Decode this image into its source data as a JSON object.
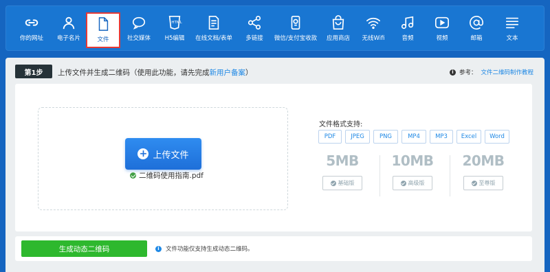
{
  "nav": {
    "items": [
      {
        "label": "你的网址",
        "icon": "link-icon"
      },
      {
        "label": "电子名片",
        "icon": "person-icon"
      },
      {
        "label": "文件",
        "icon": "file-icon",
        "active": true
      },
      {
        "label": "社交媒体",
        "icon": "chat-bubble-icon"
      },
      {
        "label": "H5编辑",
        "icon": "html5-icon"
      },
      {
        "label": "在线文档/表单",
        "icon": "document-icon"
      },
      {
        "label": "多链接",
        "icon": "share-icon"
      },
      {
        "label": "微信/支付宝收款",
        "icon": "payment-icon"
      },
      {
        "label": "应用商店",
        "icon": "shopping-bag-icon"
      },
      {
        "label": "无线Wifi",
        "icon": "wifi-icon"
      },
      {
        "label": "音频",
        "icon": "music-note-icon"
      },
      {
        "label": "视频",
        "icon": "play-icon"
      },
      {
        "label": "邮箱",
        "icon": "at-sign-icon"
      },
      {
        "label": "文本",
        "icon": "text-lines-icon"
      }
    ]
  },
  "step": {
    "badge": "第1步",
    "title_prefix": "上传文件并生成二维码（使用此功能，请先完成",
    "title_link": "新用户备案",
    "title_suffix": "）",
    "ref_label": "参考：",
    "ref_link": "文件二维码制作教程"
  },
  "upload": {
    "button_label": "上传文件",
    "file_name": "二维码使用指南.pdf"
  },
  "formats": {
    "title": "文件格式支持:",
    "items": [
      "PDF",
      "JPEG",
      "PNG",
      "MP4",
      "MP3",
      "Excel",
      "Word"
    ]
  },
  "tiers": [
    {
      "size": "5MB",
      "label": "基础版"
    },
    {
      "size": "10MB",
      "label": "高级版"
    },
    {
      "size": "20MB",
      "label": "至尊版"
    }
  ],
  "footer": {
    "generate_label": "生成动态二维码",
    "note": "文件功能仅支持生成动态二维码。"
  },
  "colors": {
    "nav_bg": "#1976d2",
    "page_bg": "#1565c0",
    "accent": "#1e88e5",
    "generate_green": "#2eb82e",
    "active_border": "#e53935"
  }
}
